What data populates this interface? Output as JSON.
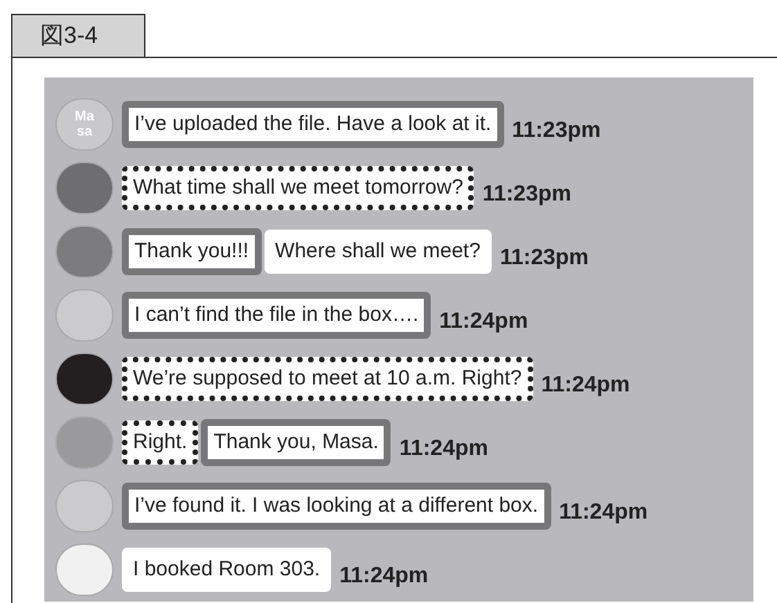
{
  "figure_label": "図3-4",
  "messages": [
    {
      "avatar": {
        "color": "#c9c9cb",
        "label": "Ma sa"
      },
      "segments": [
        {
          "text": "I’ve uploaded the file. Have a look at it.",
          "kind": "solid"
        }
      ],
      "time": "11:23pm"
    },
    {
      "avatar": {
        "color": "#6e6e70"
      },
      "segments": [
        {
          "text": "What time shall we meet tomorrow?",
          "kind": "dotted"
        }
      ],
      "time": "11:23pm"
    },
    {
      "avatar": {
        "color": "#7c7c7e"
      },
      "segments": [
        {
          "text": "Thank you!!!",
          "kind": "solid"
        },
        {
          "text": "Where shall we meet?",
          "kind": "plain"
        }
      ],
      "time": "11:23pm"
    },
    {
      "avatar": {
        "color": "#cbcbcd"
      },
      "segments": [
        {
          "text": "I can’t find the file in the box….",
          "kind": "solid"
        }
      ],
      "time": "11:24pm"
    },
    {
      "avatar": {
        "color": "#231f20"
      },
      "segments": [
        {
          "text": "We’re supposed to meet at 10 a.m.  Right?",
          "kind": "dotted"
        }
      ],
      "time": "11:24pm"
    },
    {
      "avatar": {
        "color": "#9a9a9c"
      },
      "segments": [
        {
          "text": "Right.",
          "kind": "dotted"
        },
        {
          "text": "Thank you, Masa.",
          "kind": "solid"
        }
      ],
      "time": "11:24pm"
    },
    {
      "avatar": {
        "color": "#cbcbcd"
      },
      "segments": [
        {
          "text": "I’ve found it. I was looking at a different box.",
          "kind": "solid"
        }
      ],
      "time": "11:24pm"
    },
    {
      "avatar": {
        "color": "#f0f1f0"
      },
      "segments": [
        {
          "text": "I booked Room 303.",
          "kind": "plain"
        }
      ],
      "time": "11:24pm"
    }
  ]
}
